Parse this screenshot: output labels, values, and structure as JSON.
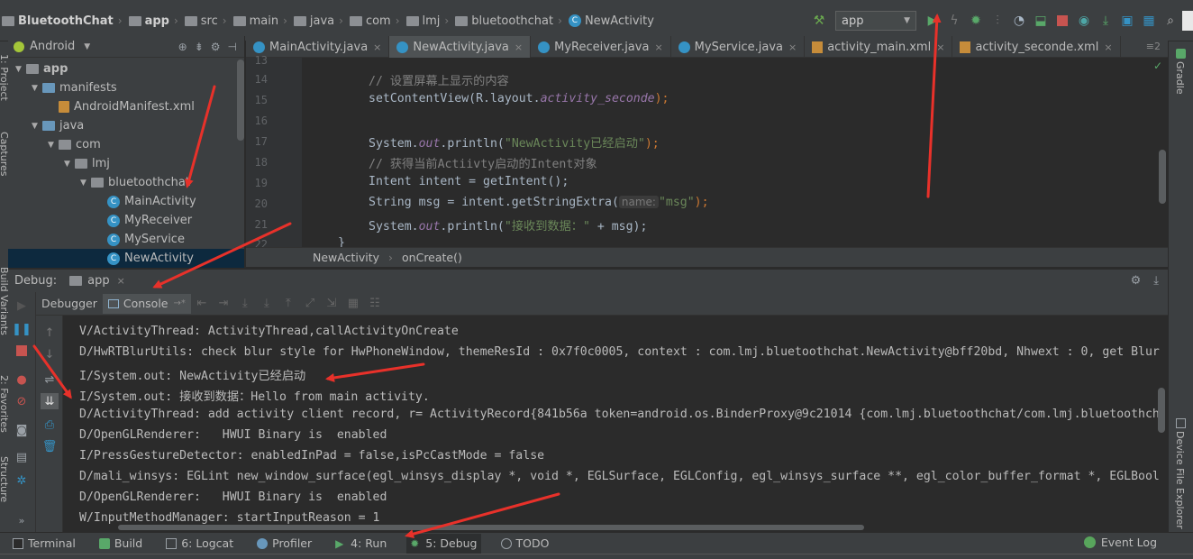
{
  "navbar": {
    "crumbs": [
      {
        "label": "BluetoothChat",
        "icon": "folder-icon"
      },
      {
        "label": "app",
        "icon": "module-folder-icon"
      },
      {
        "label": "src",
        "icon": "folder-icon"
      },
      {
        "label": "main",
        "icon": "folder-icon"
      },
      {
        "label": "java",
        "icon": "folder-icon"
      },
      {
        "label": "com",
        "icon": "package-icon"
      },
      {
        "label": "lmj",
        "icon": "package-icon"
      },
      {
        "label": "bluetoothchat",
        "icon": "package-icon"
      },
      {
        "label": "NewActivity",
        "icon": "class-icon"
      }
    ],
    "run_config": "app",
    "toolbar_icons": [
      "hammer-icon",
      "run-icon",
      "apply-changes-icon",
      "debug-icon",
      "attach-debugger-icon",
      "profile-icon",
      "sync-icon",
      "stop-icon",
      "gradle-sync-icon",
      "sdk-manager-icon",
      "avd-manager-icon",
      "structure-icon",
      "search-icon"
    ]
  },
  "project": {
    "view": "Android",
    "tree": [
      {
        "label": "app",
        "level": 0,
        "kind": "module",
        "expanded": true
      },
      {
        "label": "manifests",
        "level": 1,
        "kind": "folder",
        "expanded": true
      },
      {
        "label": "AndroidManifest.xml",
        "level": 2,
        "kind": "xml"
      },
      {
        "label": "java",
        "level": 1,
        "kind": "folder",
        "expanded": true
      },
      {
        "label": "com",
        "level": 2,
        "kind": "package",
        "expanded": true
      },
      {
        "label": "lmj",
        "level": 3,
        "kind": "package",
        "expanded": true
      },
      {
        "label": "bluetoothchat",
        "level": 4,
        "kind": "package",
        "expanded": true
      },
      {
        "label": "MainActivity",
        "level": 5,
        "kind": "class"
      },
      {
        "label": "MyReceiver",
        "level": 5,
        "kind": "class"
      },
      {
        "label": "MyService",
        "level": 5,
        "kind": "class"
      },
      {
        "label": "NewActivity",
        "level": 5,
        "kind": "class",
        "selected": true
      }
    ]
  },
  "left_strip": {
    "labels": [
      "1: Project",
      "Captures",
      "Build Variants",
      "2: Favorites",
      "Structure"
    ]
  },
  "right_strip": {
    "labels": [
      "Gradle",
      "Device File Explorer"
    ]
  },
  "editor": {
    "tabs": [
      {
        "label": "MainActivity.java",
        "kind": "class"
      },
      {
        "label": "NewActivity.java",
        "kind": "class",
        "active": true
      },
      {
        "label": "MyReceiver.java",
        "kind": "class"
      },
      {
        "label": "MyService.java",
        "kind": "class"
      },
      {
        "label": "activity_main.xml",
        "kind": "xml"
      },
      {
        "label": "activity_seconde.xml",
        "kind": "xml"
      }
    ],
    "tab_overflow": "≡2",
    "line_numbers": [
      "13",
      "14",
      "15",
      "16",
      "17",
      "18",
      "19",
      "20",
      "21",
      "22"
    ],
    "code": {
      "l14": "// 设置屏幕上显示的内容",
      "l15a": "setContentView(R.layout.",
      "l15b": "activity_seconde",
      "l15c": ");",
      "l17a": "System.",
      "l17b": "out",
      "l17c": ".println(",
      "l17d": "\"NewActivity已经启动\"",
      "l17e": ");",
      "l18": "// 获得当前Actiivty启动的Intent对象",
      "l19": "Intent intent = getIntent();",
      "l20a": "String msg = intent.getStringExtra(",
      "l20hint": "name:",
      "l20b": "\"msg\"",
      "l20c": ");",
      "l21a": "System.",
      "l21b": "out",
      "l21c": ".println(",
      "l21d": "\"接收到数据：\"",
      "l21e": " + msg);",
      "l22": "}"
    },
    "breadcrumb": [
      "NewActivity",
      "onCreate()"
    ]
  },
  "debug": {
    "title": "Debug:",
    "config": "app",
    "tabs": [
      {
        "label": "Debugger"
      },
      {
        "label": "Console",
        "active": true
      }
    ],
    "console_lines": [
      "V/ActivityThread: ActivityThread,callActivityOnCreate",
      "D/HwRTBlurUtils: check blur style for HwPhoneWindow, themeResId : 0x7f0c0005, context : com.lmj.bluetoothchat.NewActivity@bff20bd, Nhwext : 0, get Blur",
      "I/System.out: NewActivity已经启动",
      "I/System.out: 接收到数据：Hello from main activity.",
      "D/ActivityThread: add activity client record, r= ActivityRecord{841b56a token=android.os.BinderProxy@9c21014 {com.lmj.bluetoothchat/com.lmj.bluetoothch",
      "D/OpenGLRenderer:   HWUI Binary is  enabled",
      "I/PressGestureDetector: enabledInPad = false,isPcCastMode = false",
      "D/mali_winsys: EGLint new_window_surface(egl_winsys_display *, void *, EGLSurface, EGLConfig, egl_winsys_surface **, egl_color_buffer_format *, EGLBool",
      "D/OpenGLRenderer:   HWUI Binary is  enabled",
      "W/InputMethodManager: startInputReason = 1"
    ]
  },
  "bottom_bar": {
    "tools": [
      {
        "label": "Terminal",
        "icon": "terminal-icon"
      },
      {
        "label": "Build",
        "icon": "build-icon"
      },
      {
        "label": "6: Logcat",
        "icon": "logcat-icon"
      },
      {
        "label": "Profiler",
        "icon": "profiler-icon"
      },
      {
        "label": "4: Run",
        "icon": "run-icon"
      },
      {
        "label": "5: Debug",
        "icon": "debug-icon",
        "active": true
      },
      {
        "label": "TODO",
        "icon": "todo-icon"
      }
    ],
    "event_log": "Event Log"
  },
  "colors": {
    "annotation_arrow": "#e8312a",
    "selection": "#0d293e",
    "accent_blue": "#3592c4"
  }
}
